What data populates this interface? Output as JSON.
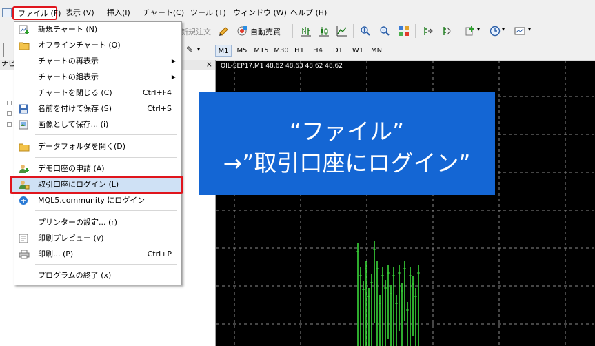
{
  "menubar": {
    "items": [
      "ファイル (F)",
      "表示 (V)",
      "挿入(I)",
      "チャート(C)",
      "ツール (T)",
      "ウィンドウ (W)",
      "ヘルプ (H)"
    ]
  },
  "toolbar": {
    "new_order_label": "新規注文",
    "auto_trade_label": "自動売買"
  },
  "timeframes": [
    "M1",
    "M5",
    "M15",
    "M30",
    "H1",
    "H4",
    "D1",
    "W1",
    "MN"
  ],
  "navigator": {
    "title": "ナビ",
    "close_glyph": "×"
  },
  "chart": {
    "title": "OIL-SEP17,M1  48.62 48.63 48.62 48.62"
  },
  "file_menu": {
    "items": [
      {
        "label": "新規チャート (N)",
        "shortcut": ""
      },
      {
        "label": "オフラインチャート (O)",
        "shortcut": ""
      },
      {
        "label": "チャートの再表示",
        "shortcut": "",
        "submenu": true
      },
      {
        "label": "チャートの組表示",
        "shortcut": "",
        "submenu": true
      },
      {
        "label": "チャートを閉じる (C)",
        "shortcut": "Ctrl+F4"
      },
      {
        "label": "名前を付けて保存 (S)",
        "shortcut": "Ctrl+S"
      },
      {
        "label": "画像として保存... (i)",
        "shortcut": ""
      },
      {
        "label": "データフォルダを開く(D)",
        "shortcut": ""
      },
      {
        "label": "デモ口座の申請 (A)",
        "shortcut": ""
      },
      {
        "label": "取引口座にログイン (L)",
        "shortcut": ""
      },
      {
        "label": "MQL5.community にログイン",
        "shortcut": ""
      },
      {
        "label": "プリンターの設定... (r)",
        "shortcut": ""
      },
      {
        "label": "印刷プレビュー (v)",
        "shortcut": ""
      },
      {
        "label": "印刷... (P)",
        "shortcut": "Ctrl+P"
      },
      {
        "label": "プログラムの終了 (x)",
        "shortcut": ""
      }
    ]
  },
  "callout": {
    "line1": "“ファイル”",
    "line2": "→”取引口座にログイン”"
  },
  "colors": {
    "highlight_red": "#e0151d",
    "callout_blue": "#1466d4",
    "chart_bg": "#000000",
    "candle_green": "#3ad83a"
  }
}
